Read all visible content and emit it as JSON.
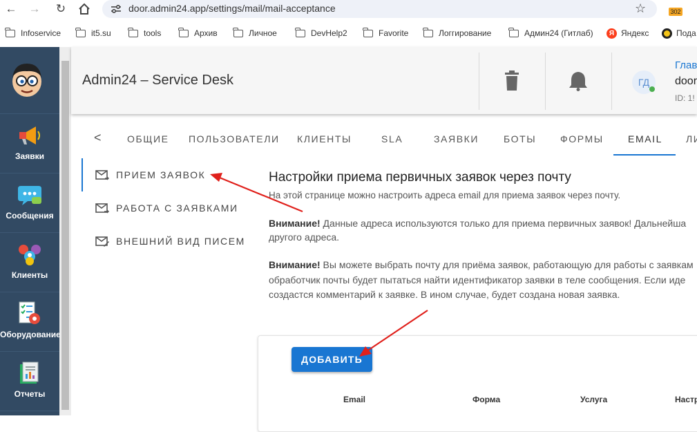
{
  "browser": {
    "url": "door.admin24.app/settings/mail/mail-acceptance",
    "extension_badge": "302",
    "bookmarks": [
      "Infoservice",
      "it5.su",
      "tools",
      "Архив",
      "Личное",
      "DevHelp2",
      "Favorite",
      "Логгирование",
      "Админ24 (Гитлаб)",
      "Яндекс",
      "Пода"
    ]
  },
  "sidebar": {
    "items": [
      {
        "label": "Заявки",
        "icon": "megaphone-icon"
      },
      {
        "label": "Сообщения",
        "icon": "chat-bubble-icon"
      },
      {
        "label": "Клиенты",
        "icon": "clients-icon"
      },
      {
        "label": "Оборудование",
        "icon": "equipment-checklist-icon"
      },
      {
        "label": "Отчеты",
        "icon": "reports-icon"
      }
    ]
  },
  "header": {
    "title": "Admin24 – Service Desk",
    "avatar_initials": "ГД",
    "user_link": "Глав",
    "user_name": "door",
    "user_id": "ID: 1!",
    "status_color": "#4caf50"
  },
  "tabs": [
    {
      "label": "<",
      "active": false
    },
    {
      "label": "ОБЩИЕ",
      "active": false
    },
    {
      "label": "ПОЛЬЗОВАТЕЛИ",
      "active": false
    },
    {
      "label": "КЛИЕНТЫ",
      "active": false
    },
    {
      "label": "SLA",
      "active": false
    },
    {
      "label": "ЗАЯВКИ",
      "active": false
    },
    {
      "label": "БОТЫ",
      "active": false
    },
    {
      "label": "ФОРМЫ",
      "active": false
    },
    {
      "label": "EMAIL",
      "active": true
    },
    {
      "label": "ЛИ",
      "active": false
    }
  ],
  "subnav": [
    {
      "label": "ПРИЕМ ЗАЯВОК",
      "active": true
    },
    {
      "label": "РАБОТА С ЗАЯВКАМИ",
      "active": false
    },
    {
      "label": "ВНЕШНИЙ ВИД ПИСЕМ",
      "active": false
    }
  ],
  "main": {
    "title": "Настройки приема первичных заявок через почту",
    "subtitle": "На этой странице можно настроить адреса email для приема заявок через почту.",
    "warn_label": "Внимание!",
    "warn1_line1": " Данные адреса используются только для приема первичных заявок! Дальнейша",
    "warn1_line2": "другого адреса.",
    "warn2_line1": " Вы можете выбрать почту для приёма заявок, работающую для работы с заявкам",
    "warn2_line2": "обработчик почты будет пытаться найти идентификатор заявки в теле сообщения. Если иде",
    "warn2_line3": "создастся комментарий к заявке. В ином случае, будет создана новая заявка.",
    "add_button": "ДОБАВИТЬ",
    "table_headers": [
      "Email",
      "Форма",
      "Услуга",
      "Настр"
    ]
  },
  "colors": {
    "accent": "#1976d2",
    "sidebar": "#324a63",
    "annotation_arrow": "#e0201b"
  }
}
